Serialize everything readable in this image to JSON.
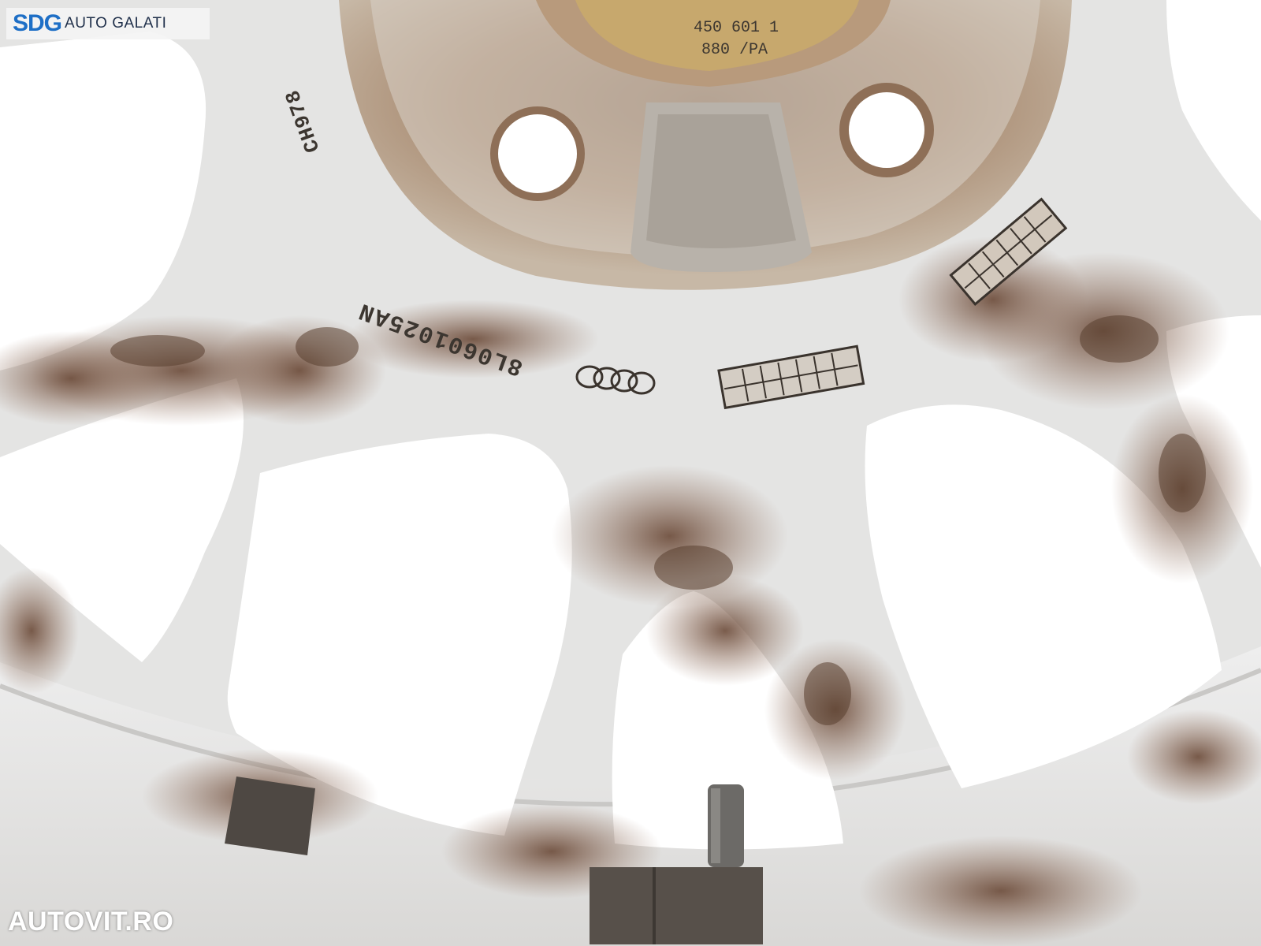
{
  "branding": {
    "brand_mark": "SDG",
    "brand_location": "AUTO GALATI",
    "watermark": "AUTOVIT.RO"
  },
  "wheel_markings": {
    "part_number": "8L0601025AN",
    "date_code": "CH978",
    "hub_stamp_line1": "450 601 1",
    "hub_stamp_line2": "880 /PA"
  },
  "colors": {
    "wheel_paint": "#e9eaea",
    "rust": "#7d5a45",
    "hub_rust": "#a9805f",
    "background": "#ffffff",
    "brand_blue": "#1e6fc6"
  }
}
